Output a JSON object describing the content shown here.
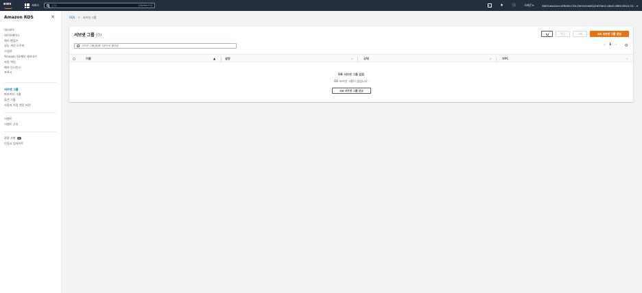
{
  "topnav": {
    "logo": "aws",
    "services_label": "서비스",
    "search_placeholder": "검색",
    "search_shortcut": "[Option+S]",
    "region": "오레곤 ▾",
    "account": "AWSLabsUser-dF8dHn133u7bhYz4hdlKLJ5d33dh2-46a0-4860-8044-33... ▾"
  },
  "sidebar": {
    "title": "Amazon RDS",
    "group1": [
      "대시보드",
      "데이터베이스",
      "쿼리 편집기",
      "성능 개선 도우미",
      "스냅샷",
      "Amazon S3에서 내보내기",
      "자동 백업",
      "예약 인스턴스",
      "프록시"
    ],
    "group2": [
      "서브넷 그룹",
      "파라미터 그룹",
      "옵션 그룹",
      "사용자 지정 엔진 버전"
    ],
    "group3": [
      "이벤트",
      "이벤트 구독"
    ],
    "group4": [
      "권장 사항",
      "인증서 업데이트"
    ],
    "badge": "0"
  },
  "breadcrumb": {
    "root": "RDS",
    "sep": ">",
    "current": "서브넷 그룹"
  },
  "panel": {
    "title": "서브넷 그룹",
    "count": "(0)",
    "edit_label": "편집",
    "delete_label": "삭제",
    "create_label": "DB 서브넷 그룹 생성",
    "filter_placeholder": "서브넷 그룹(들)을 기준으로 필터링",
    "page": "1",
    "prev": "‹",
    "next": "›",
    "columns": [
      "이름",
      "설명",
      "상태",
      "VPC"
    ],
    "empty_title": "DB 서브넷 그룹 없음",
    "empty_sub": "DB 서브넷 그룹이 없습니다.",
    "empty_button": "DB 서브넷 그룹 생성"
  }
}
